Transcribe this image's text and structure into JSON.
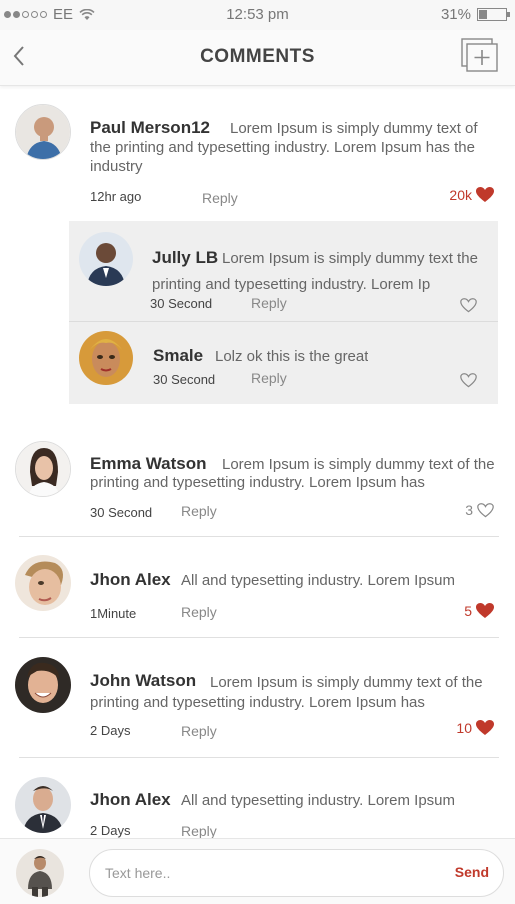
{
  "status": {
    "carrier": "EE",
    "time": "12:53 pm",
    "battery": "31%"
  },
  "header": {
    "title": "COMMENTS"
  },
  "comments": [
    {
      "name": "Paul Merson12",
      "text": "Lorem Ipsum is simply dummy text of the printing and typesetting industry. Lorem Ipsum has the industry",
      "time": "12hr ago",
      "reply": "Reply",
      "likes": "20k",
      "liked": true
    },
    {
      "name": "Jully LB",
      "text": "Lorem Ipsum is simply dummy text the printing and typesetting industry. Lorem Ip",
      "time": "30 Second",
      "reply": "Reply",
      "likes": "",
      "liked": false
    },
    {
      "name": "Smale",
      "text": "Lolz ok this is the great",
      "time": "30 Second",
      "reply": "Reply",
      "likes": "",
      "liked": false
    },
    {
      "name": "Emma Watson",
      "text": "Lorem Ipsum is simply dummy text of the printing and typesetting industry. Lorem Ipsum has",
      "time": "30 Second",
      "reply": "Reply",
      "likes": "3",
      "liked": false
    },
    {
      "name": "Jhon Alex",
      "text": "All  and typesetting industry. Lorem Ipsum",
      "time": "1Minute",
      "reply": "Reply",
      "likes": "5",
      "liked": true
    },
    {
      "name": "John Watson",
      "text": "Lorem Ipsum is simply dummy text of the printing and typesetting industry. Lorem Ipsum has",
      "time": "2 Days",
      "reply": "Reply",
      "likes": "10",
      "liked": true
    },
    {
      "name": "Jhon Alex",
      "text": "All  and typesetting industry. Lorem Ipsum",
      "time": "2 Days",
      "reply": "Reply",
      "likes": "",
      "liked": false
    }
  ],
  "composer": {
    "placeholder": "Text here..",
    "send_label": "Send"
  },
  "colors": {
    "accent": "#c0392b",
    "reply_bg": "#efefef"
  }
}
